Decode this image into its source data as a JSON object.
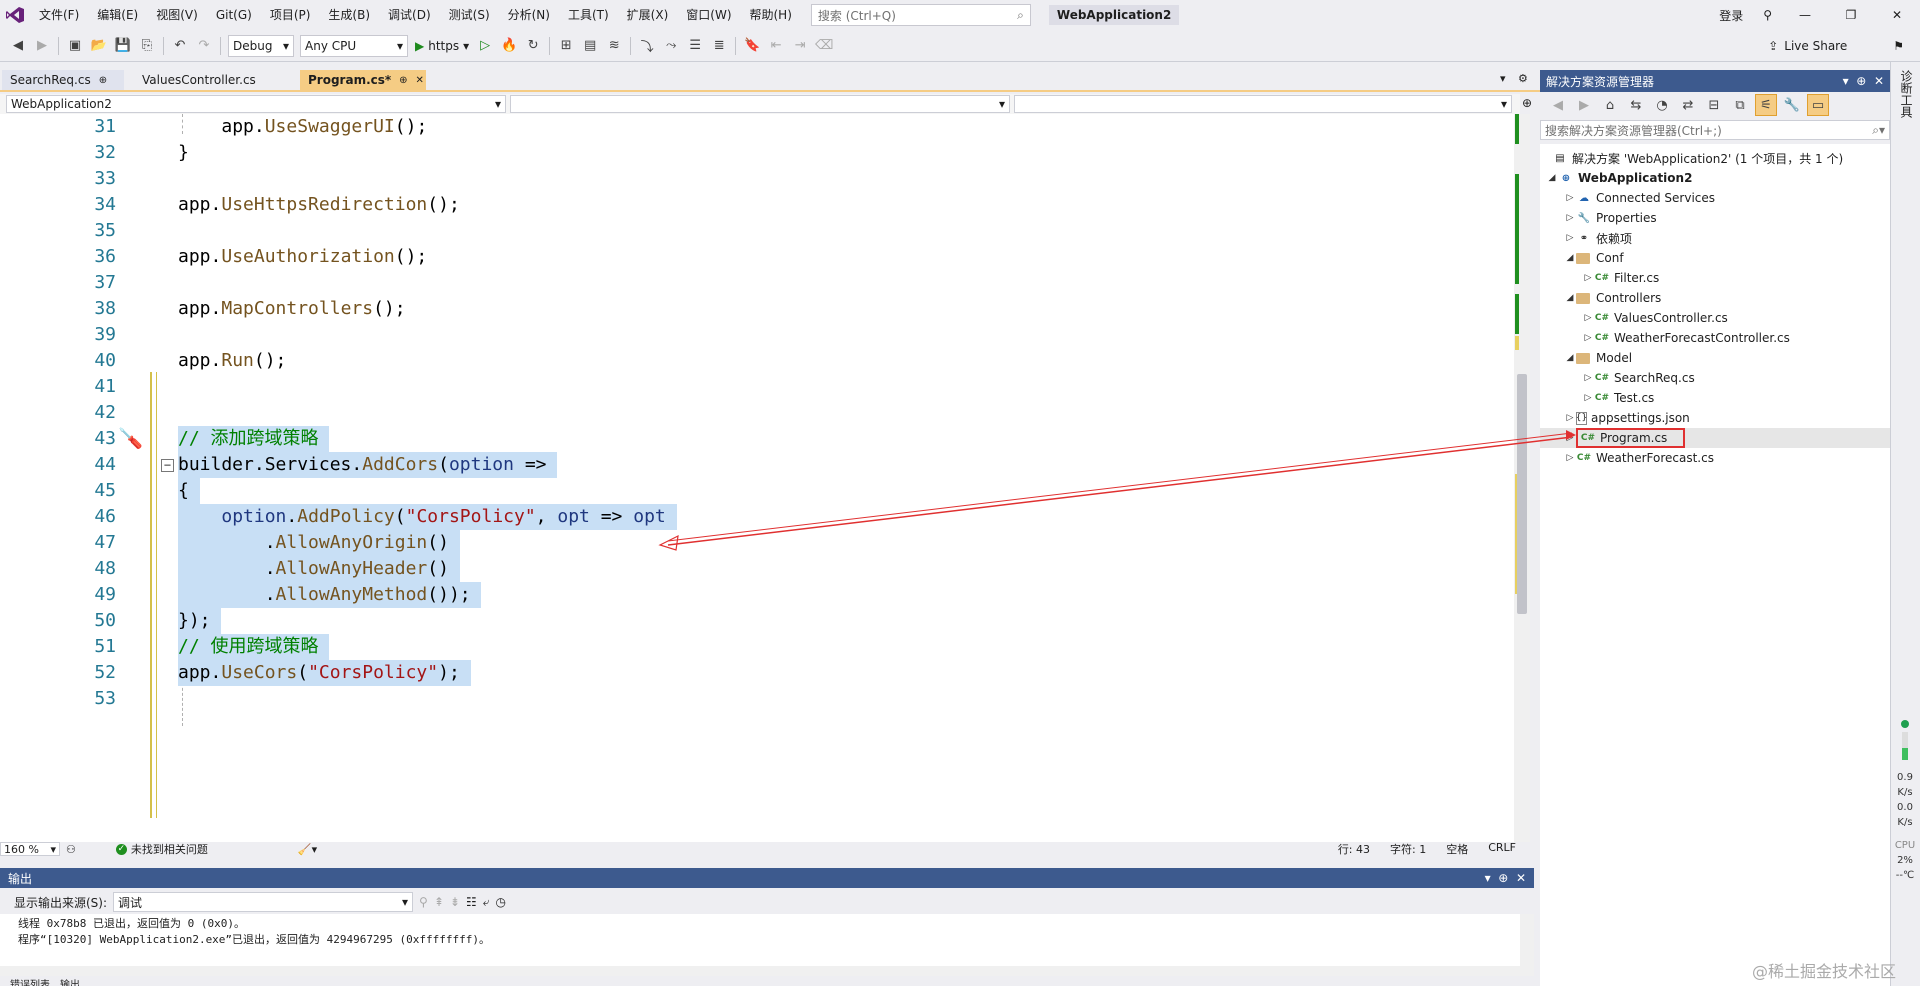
{
  "menubar": {
    "items": [
      "文件(F)",
      "编辑(E)",
      "视图(V)",
      "Git(G)",
      "项目(P)",
      "生成(B)",
      "调试(D)",
      "测试(S)",
      "分析(N)",
      "工具(T)",
      "扩展(X)",
      "窗口(W)",
      "帮助(H)"
    ],
    "search_placeholder": "搜索 (Ctrl+Q)",
    "solution_name": "WebApplication2",
    "login": "登录"
  },
  "toolbar": {
    "config": "Debug",
    "platform": "Any CPU",
    "run_profile": "https",
    "live_share": "Live Share"
  },
  "tabs": [
    {
      "label": "SearchReq.cs",
      "pin": "⊕"
    },
    {
      "label": "ValuesController.cs"
    },
    {
      "label": "Program.cs*",
      "pin": "⊕",
      "close": "✕"
    }
  ],
  "navbar": {
    "project": "WebApplication2"
  },
  "code_lines": [
    {
      "n": "31"
    },
    {
      "n": "32"
    },
    {
      "n": "33"
    },
    {
      "n": "34"
    },
    {
      "n": "35"
    },
    {
      "n": "36"
    },
    {
      "n": "37"
    },
    {
      "n": "38"
    },
    {
      "n": "39"
    },
    {
      "n": "40"
    },
    {
      "n": "41"
    },
    {
      "n": "42"
    },
    {
      "n": "43"
    },
    {
      "n": "44"
    },
    {
      "n": "45"
    },
    {
      "n": "46"
    },
    {
      "n": "47"
    },
    {
      "n": "48"
    },
    {
      "n": "49"
    },
    {
      "n": "50"
    },
    {
      "n": "51"
    },
    {
      "n": "52"
    },
    {
      "n": "53"
    }
  ],
  "code": {
    "app": "app",
    "builder": "builder",
    "UseSwaggerUI": "UseSwaggerUI",
    "UseHttpsRedirection": "UseHttpsRedirection",
    "UseAuthorization": "UseAuthorization",
    "MapControllers": "MapControllers",
    "Run": "Run",
    "comment_add": "// 添加跨域策略",
    "Services": "Services",
    "AddCors": "AddCors",
    "option": "option",
    "AddPolicy": "AddPolicy",
    "cors_str": "\"CorsPolicy\"",
    "opt": "opt",
    "AllowAnyOrigin": "AllowAnyOrigin",
    "AllowAnyHeader": "AllowAnyHeader",
    "AllowAnyMethod": "AllowAnyMethod",
    "comment_use": "// 使用跨域策略",
    "UseCors": "UseCors"
  },
  "status": {
    "zoom": "160 %",
    "issues": "未找到相关问题",
    "row": "行: 43",
    "col": "字符: 1",
    "space": "空格",
    "eol": "CRLF"
  },
  "output": {
    "title": "输出",
    "source_label": "显示输出来源(S):",
    "source_value": "调试",
    "lines": [
      "线程 0x78b8 已退出，返回值为 0 (0x0)。",
      "程序“[10320] WebApplication2.exe”已退出，返回值为 4294967295 (0xffffffff)。"
    ],
    "bottom_tabs": [
      "错误列表",
      "输出"
    ]
  },
  "solution_explorer": {
    "title": "解决方案资源管理器",
    "search_placeholder": "搜索解决方案资源管理器(Ctrl+;)",
    "nodes": [
      {
        "label": "解决方案 'WebApplication2' (1 个项目，共 1 个)",
        "icon": "solution-icon"
      },
      {
        "label": "WebApplication2",
        "icon": "project-icon"
      },
      {
        "label": "Connected Services",
        "icon": "connected-services-icon"
      },
      {
        "label": "Properties",
        "icon": "properties-icon"
      },
      {
        "label": "依赖项",
        "icon": "dependencies-icon"
      },
      {
        "label": "Conf",
        "icon": "folder-icon"
      },
      {
        "label": "Filter.cs",
        "icon": "csharp-file-icon"
      },
      {
        "label": "Controllers",
        "icon": "folder-icon"
      },
      {
        "label": "ValuesController.cs",
        "icon": "csharp-file-icon"
      },
      {
        "label": "WeatherForecastController.cs",
        "icon": "csharp-file-icon"
      },
      {
        "label": "Model",
        "icon": "folder-icon"
      },
      {
        "label": "SearchReq.cs",
        "icon": "csharp-file-icon"
      },
      {
        "label": "Test.cs",
        "icon": "csharp-file-icon"
      },
      {
        "label": "appsettings.json",
        "icon": "json-file-icon"
      },
      {
        "label": "Program.cs",
        "icon": "csharp-file-icon"
      },
      {
        "label": "WeatherForecast.cs",
        "icon": "csharp-file-icon"
      }
    ]
  },
  "rail": {
    "title": "诊断工具",
    "net_down": "0.9",
    "net_down_unit": "K/s",
    "net_up": "0.0",
    "net_up_unit": "K/s",
    "cpu_label": "CPU",
    "cpu_value": "2%",
    "temp": "--℃"
  },
  "watermark": "@稀土掘金技术社区",
  "colors": {
    "accent_blue": "#3d5a8e",
    "tab_active": "#f5cc84",
    "selection": "#c8dff5",
    "annotation_red": "#e03030"
  }
}
